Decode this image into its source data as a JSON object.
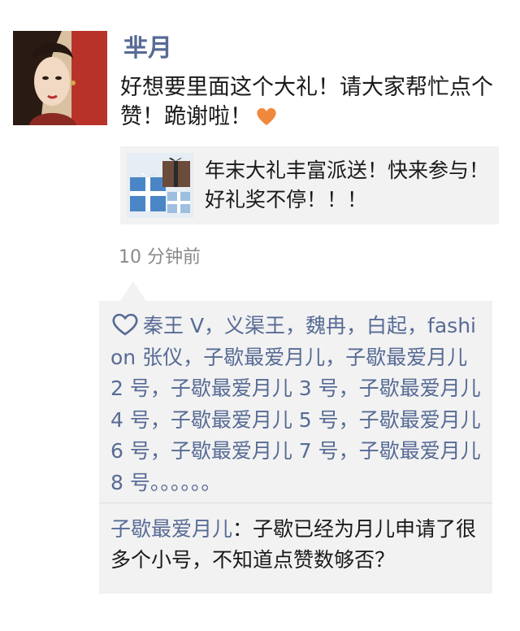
{
  "post": {
    "author": "芈月",
    "text": "好想要里面这个大礼！请大家帮忙点个赞！跪谢啦！",
    "emoji": "heart-emoji",
    "timestamp": "10 分钟前"
  },
  "link_card": {
    "title": "年末大礼丰富派送！快来参与！好礼奖不停！！！",
    "thumbnail": "gift-boxes-image"
  },
  "likes": {
    "icon": "heart-outline-icon",
    "names_text": "秦王 V，义渠王，魏冉，白起，fashion 张仪，子歇最爱月儿，子歇最爱月儿 2 号，子歇最爱月儿 3 号，子歇最爱月儿 4 号，子歇最爱月儿 5 号，子歇最爱月儿 6 号，子歇最爱月儿 7 号，子歇最爱月儿 8 号。。。。。。"
  },
  "comments": [
    {
      "author": "子歇最爱月儿",
      "separator": "：",
      "text": "子歇已经为月儿申请了很多个小号，不知道点赞数够否？"
    }
  ],
  "colors": {
    "link_blue": "#576b95",
    "panel_bg": "#f2f2f2",
    "text": "#1a1a1a",
    "muted": "#8a8a8a"
  }
}
